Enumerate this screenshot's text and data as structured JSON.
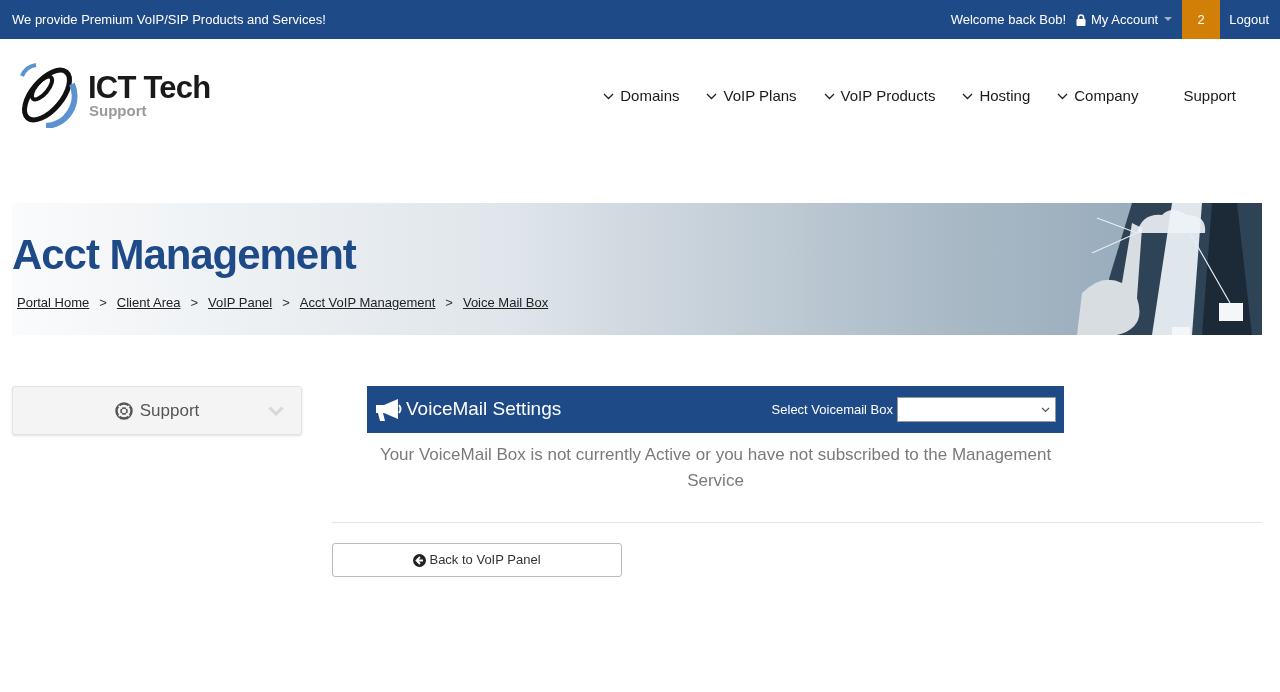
{
  "top_bar": {
    "tagline": "We provide Premium VoIP/SIP Products and Services!",
    "welcome": "Welcome back Bob!",
    "account": "My Account",
    "badge": "2",
    "logout": "Logout"
  },
  "logo": {
    "title": "ICT Tech",
    "subtitle": "Support"
  },
  "nav": [
    {
      "label": "Domains",
      "dropdown": true
    },
    {
      "label": "VoIP Plans",
      "dropdown": true
    },
    {
      "label": "VoIP Products",
      "dropdown": true
    },
    {
      "label": "Hosting",
      "dropdown": true
    },
    {
      "label": "Company",
      "dropdown": true
    },
    {
      "label": "Support",
      "dropdown": false
    }
  ],
  "header": {
    "title": "Acct Management",
    "breadcrumbs": [
      "Portal Home",
      "Client Area",
      "VoIP Panel",
      "Acct VoIP Management",
      "Voice Mail Box"
    ],
    "separator": ">",
    "banner": {
      "kind": "picture"
    }
  },
  "sidebar": {
    "label": "Support",
    "expanded": false
  },
  "panel": {
    "title": "VoiceMail Settings",
    "select_label": "Select Voicemail Box",
    "message": "Your VoiceMail Box is not currently Active or you have not subscribed to the Management Service",
    "back_button": "Back to VoIP Panel"
  }
}
